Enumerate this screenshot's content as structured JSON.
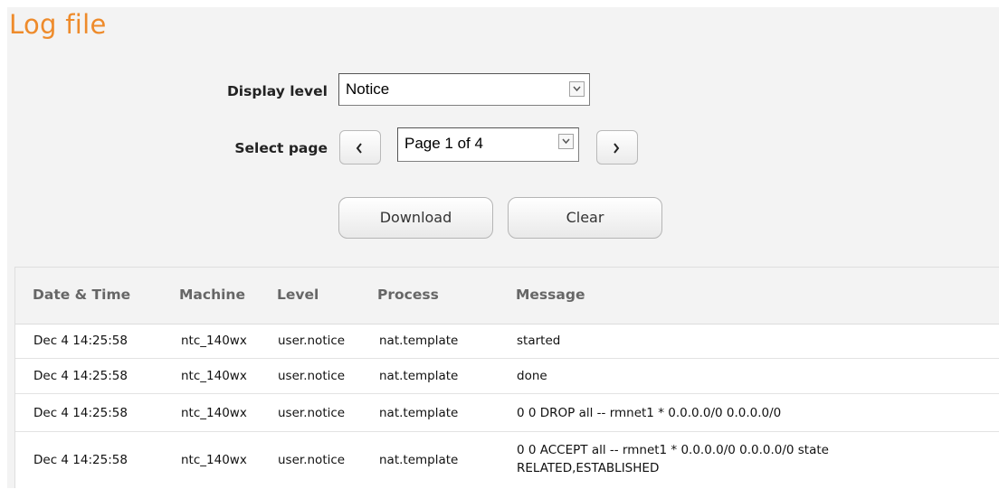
{
  "page": {
    "title": "Log file"
  },
  "controls": {
    "display_level_label": "Display level",
    "display_level_value": "Notice",
    "select_page_label": "Select page",
    "page_value": "Page 1 of 4",
    "download_label": "Download",
    "clear_label": "Clear"
  },
  "table": {
    "headers": [
      "Date & Time",
      "Machine",
      "Level",
      "Process",
      "Message"
    ],
    "rows": [
      {
        "datetime": "Dec 4 14:25:58",
        "machine": "ntc_140wx",
        "level": "user.notice",
        "process": "nat.template",
        "message": "started",
        "message2": ""
      },
      {
        "datetime": "Dec 4 14:25:58",
        "machine": "ntc_140wx",
        "level": "user.notice",
        "process": "nat.template",
        "message": "done",
        "message2": ""
      },
      {
        "datetime": "Dec 4 14:25:58",
        "machine": "ntc_140wx",
        "level": "user.notice",
        "process": "nat.template",
        "message": "0 0 DROP all -- rmnet1 * 0.0.0.0/0 0.0.0.0/0",
        "message2": ""
      },
      {
        "datetime": "Dec 4 14:25:58",
        "machine": "ntc_140wx",
        "level": "user.notice",
        "process": "nat.template",
        "message": "0 0 ACCEPT all -- rmnet1 * 0.0.0.0/0 0.0.0.0/0 state",
        "message2": "RELATED,ESTABLISHED"
      }
    ]
  },
  "colors": {
    "title": "#ee8b2b",
    "panel_bg": "#f3f3f3",
    "header_text": "#666666"
  },
  "icons": {
    "dropdown": "chevron-down-icon",
    "prev": "chevron-left-icon",
    "next": "chevron-right-icon"
  }
}
